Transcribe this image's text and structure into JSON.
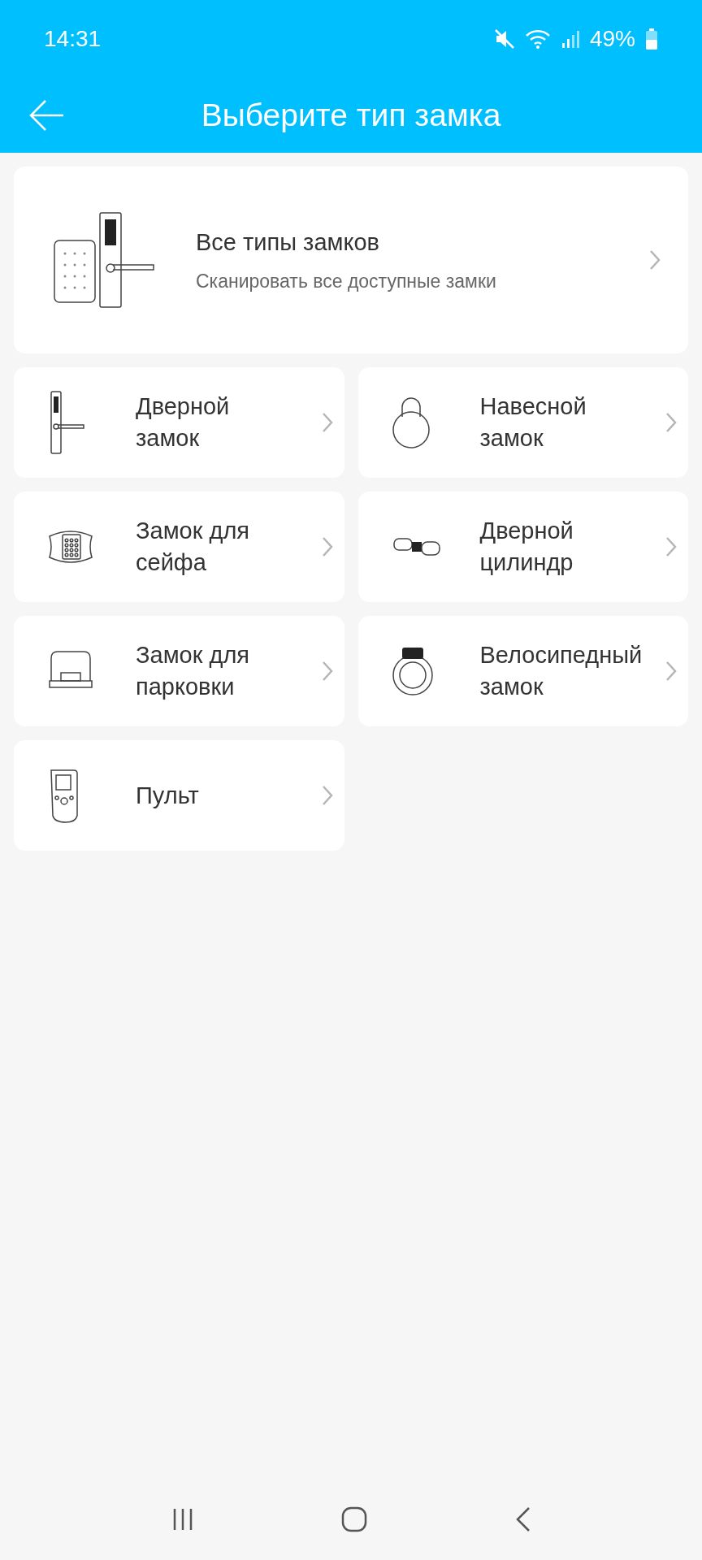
{
  "status_bar": {
    "time": "14:31",
    "battery": "49%"
  },
  "header": {
    "title": "Выберите тип замка"
  },
  "all_types": {
    "title": "Все типы замков",
    "subtitle": "Сканировать все доступные замки"
  },
  "lock_types": [
    {
      "kind": "door",
      "label": "Дверной\nзамок"
    },
    {
      "kind": "padlock",
      "label": "Навесной\nзамок"
    },
    {
      "kind": "safe",
      "label": "Замок для\nсейфа"
    },
    {
      "kind": "cylinder",
      "label": "Дверной\nцилиндр"
    },
    {
      "kind": "parking",
      "label": "Замок для\nпарковки"
    },
    {
      "kind": "bike",
      "label": "Велосипедный\nзамок"
    },
    {
      "kind": "remote",
      "label": "Пульт"
    }
  ]
}
